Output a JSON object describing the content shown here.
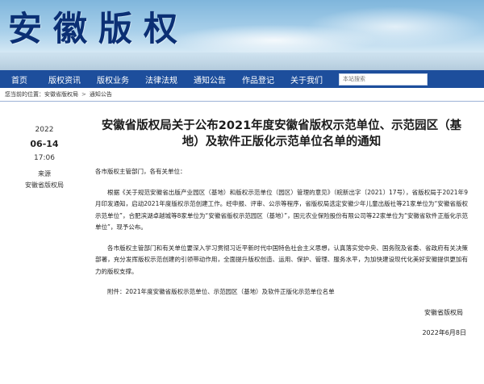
{
  "site": {
    "title": "安徽版权"
  },
  "nav": {
    "items": [
      "首页",
      "版权资讯",
      "版权业务",
      "法律法规",
      "通知公告",
      "作品登记",
      "关于我们"
    ],
    "search_placeholder": "本站搜索"
  },
  "breadcrumb": {
    "label": "您当前的位置：",
    "items": [
      "安徽省版权局",
      "通知公告"
    ],
    "separator": ">"
  },
  "meta": {
    "year": "2022",
    "date": "06-14",
    "time": "17:06",
    "source_label": "来源",
    "source": "安徽省版权局"
  },
  "article": {
    "title": "安徽省版权局关于公布2021年度安徽省版权示范单位、示范园区（基地）及软件正版化示范单位名单的通知",
    "salutation": "各市版权主管部门，各有关单位：",
    "p1": "根据《关于规范安徽省出版产业园区（基地）和版权示范单位（园区）管理的意见》（皖新出字〔2021〕17号），省版权局于2021年9月印发通知，启动2021年度版权示范创建工作。经申报、评审、公示等程序，省版权局选定安徽少年儿童出版社等21家单位为“安徽省版权示范单位”，合肥滨湖卓越城等8家单位为“安徽省版权示范园区（基地）”，国元农业保险股份有限公司等22家单位为“安徽省软件正版化示范单位”，现予公布。",
    "p2": "各市版权主管部门和有关单位要深入学习贯彻习近平新时代中国特色社会主义思想，认真落实党中央、国务院及省委、省政府有关决策部署，充分发挥版权示范创建的引领带动作用，全面提升版权创造、运用、保护、管理、服务水平，为加快建设现代化美好安徽提供更加有力的版权支撑。",
    "attachment": "附件：2021年度安徽省版权示范单位、示范园区（基地）及软件正版化示范单位名单",
    "signer": "安徽省版权局",
    "sign_date": "2022年6月8日"
  }
}
